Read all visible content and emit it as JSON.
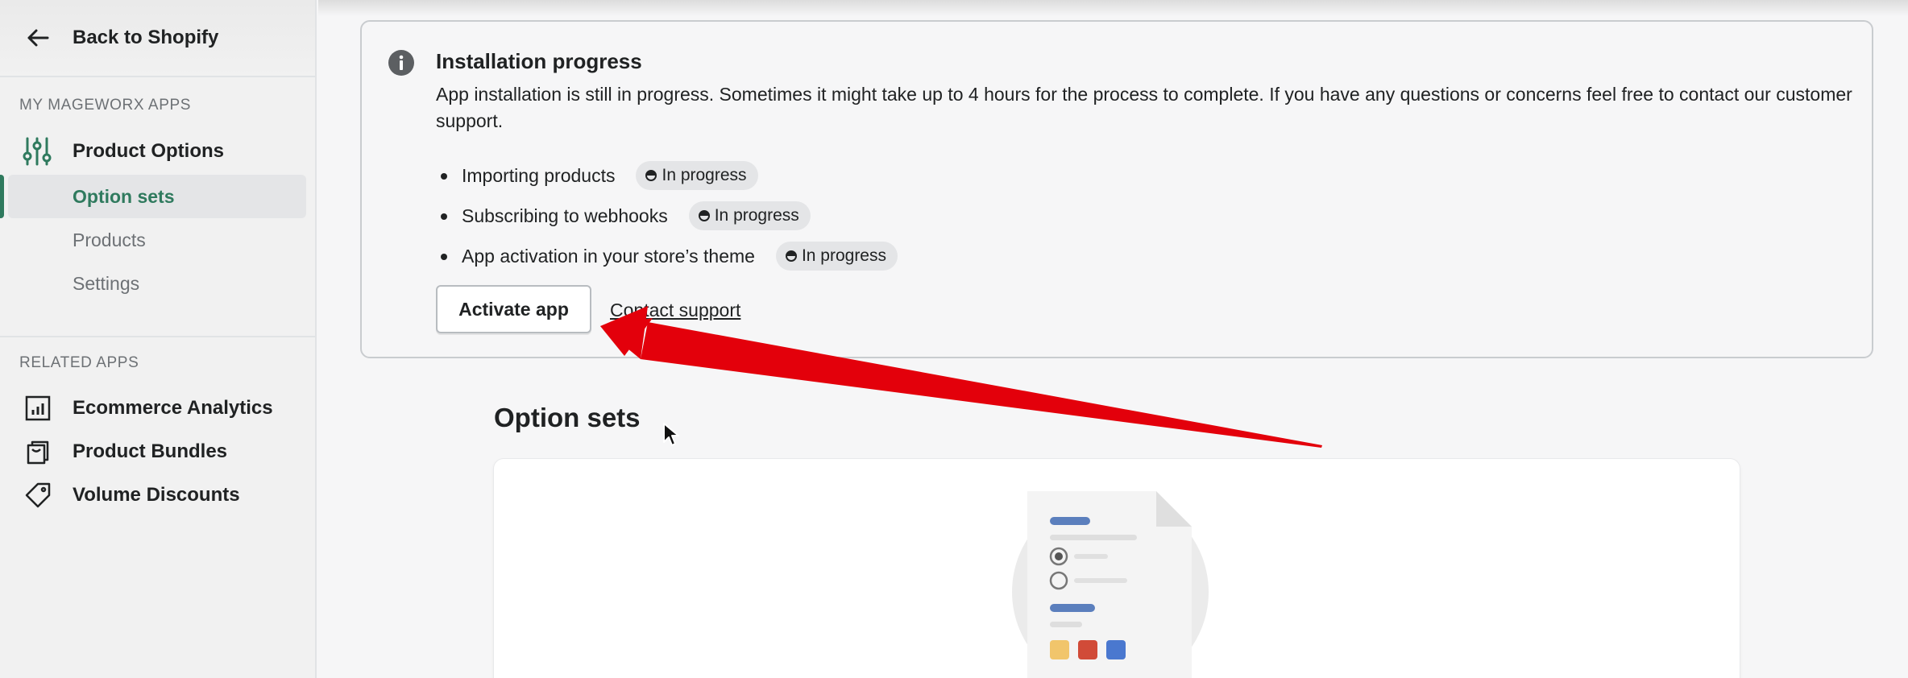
{
  "sidebar": {
    "back_label": "Back to Shopify",
    "my_apps_title": "MY MAGEWORX APPS",
    "product_options_label": "Product Options",
    "items": [
      {
        "label": "Option sets"
      },
      {
        "label": "Products"
      },
      {
        "label": "Settings"
      }
    ],
    "related_title": "RELATED APPS",
    "related": [
      {
        "label": "Ecommerce Analytics",
        "icon": "bar-chart-icon"
      },
      {
        "label": "Product Bundles",
        "icon": "bundle-icon"
      },
      {
        "label": "Volume Discounts",
        "icon": "tag-icon"
      }
    ]
  },
  "banner": {
    "title": "Installation progress",
    "text": "App installation is still in progress. Sometimes it might take up to 4 hours for the process to complete. If you have any questions or concerns feel free to contact our customer support.",
    "steps": [
      {
        "label": "Importing products",
        "status": "In progress"
      },
      {
        "label": "Subscribing to webhooks",
        "status": "In progress"
      },
      {
        "label": "App activation in your store’s theme",
        "status": "In progress"
      }
    ],
    "activate_label": "Activate app",
    "contact_label": "Contact support"
  },
  "main": {
    "page_title": "Option sets"
  },
  "colors": {
    "accent": "#2f7a5e",
    "arrow": "#e3000b",
    "illustration_blue": "#5b7fbd",
    "swatch_yellow": "#f1c56b",
    "swatch_red": "#d14b38",
    "swatch_blue": "#4a78cf"
  }
}
